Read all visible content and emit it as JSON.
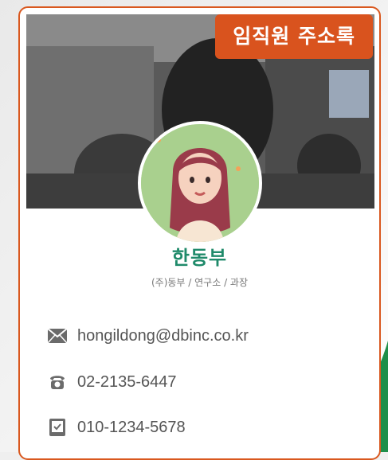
{
  "badge": {
    "label": "임직원 주소록"
  },
  "profile": {
    "name": "한동부",
    "subtitle": "(주)동부 / 연구소 / 과장"
  },
  "contacts": {
    "email": "hongildong@dbinc.co.kr",
    "phone": "02-2135-6447",
    "mobile": "010-1234-5678"
  },
  "icons": {
    "email": "envelope-icon",
    "phone": "telephone-icon",
    "mobile": "mobile-phone-icon"
  },
  "colors": {
    "accent": "#d9531e",
    "name": "#1f8a6a",
    "avatar_bg": "#a9d08e",
    "corner": "#1e8f4a"
  }
}
